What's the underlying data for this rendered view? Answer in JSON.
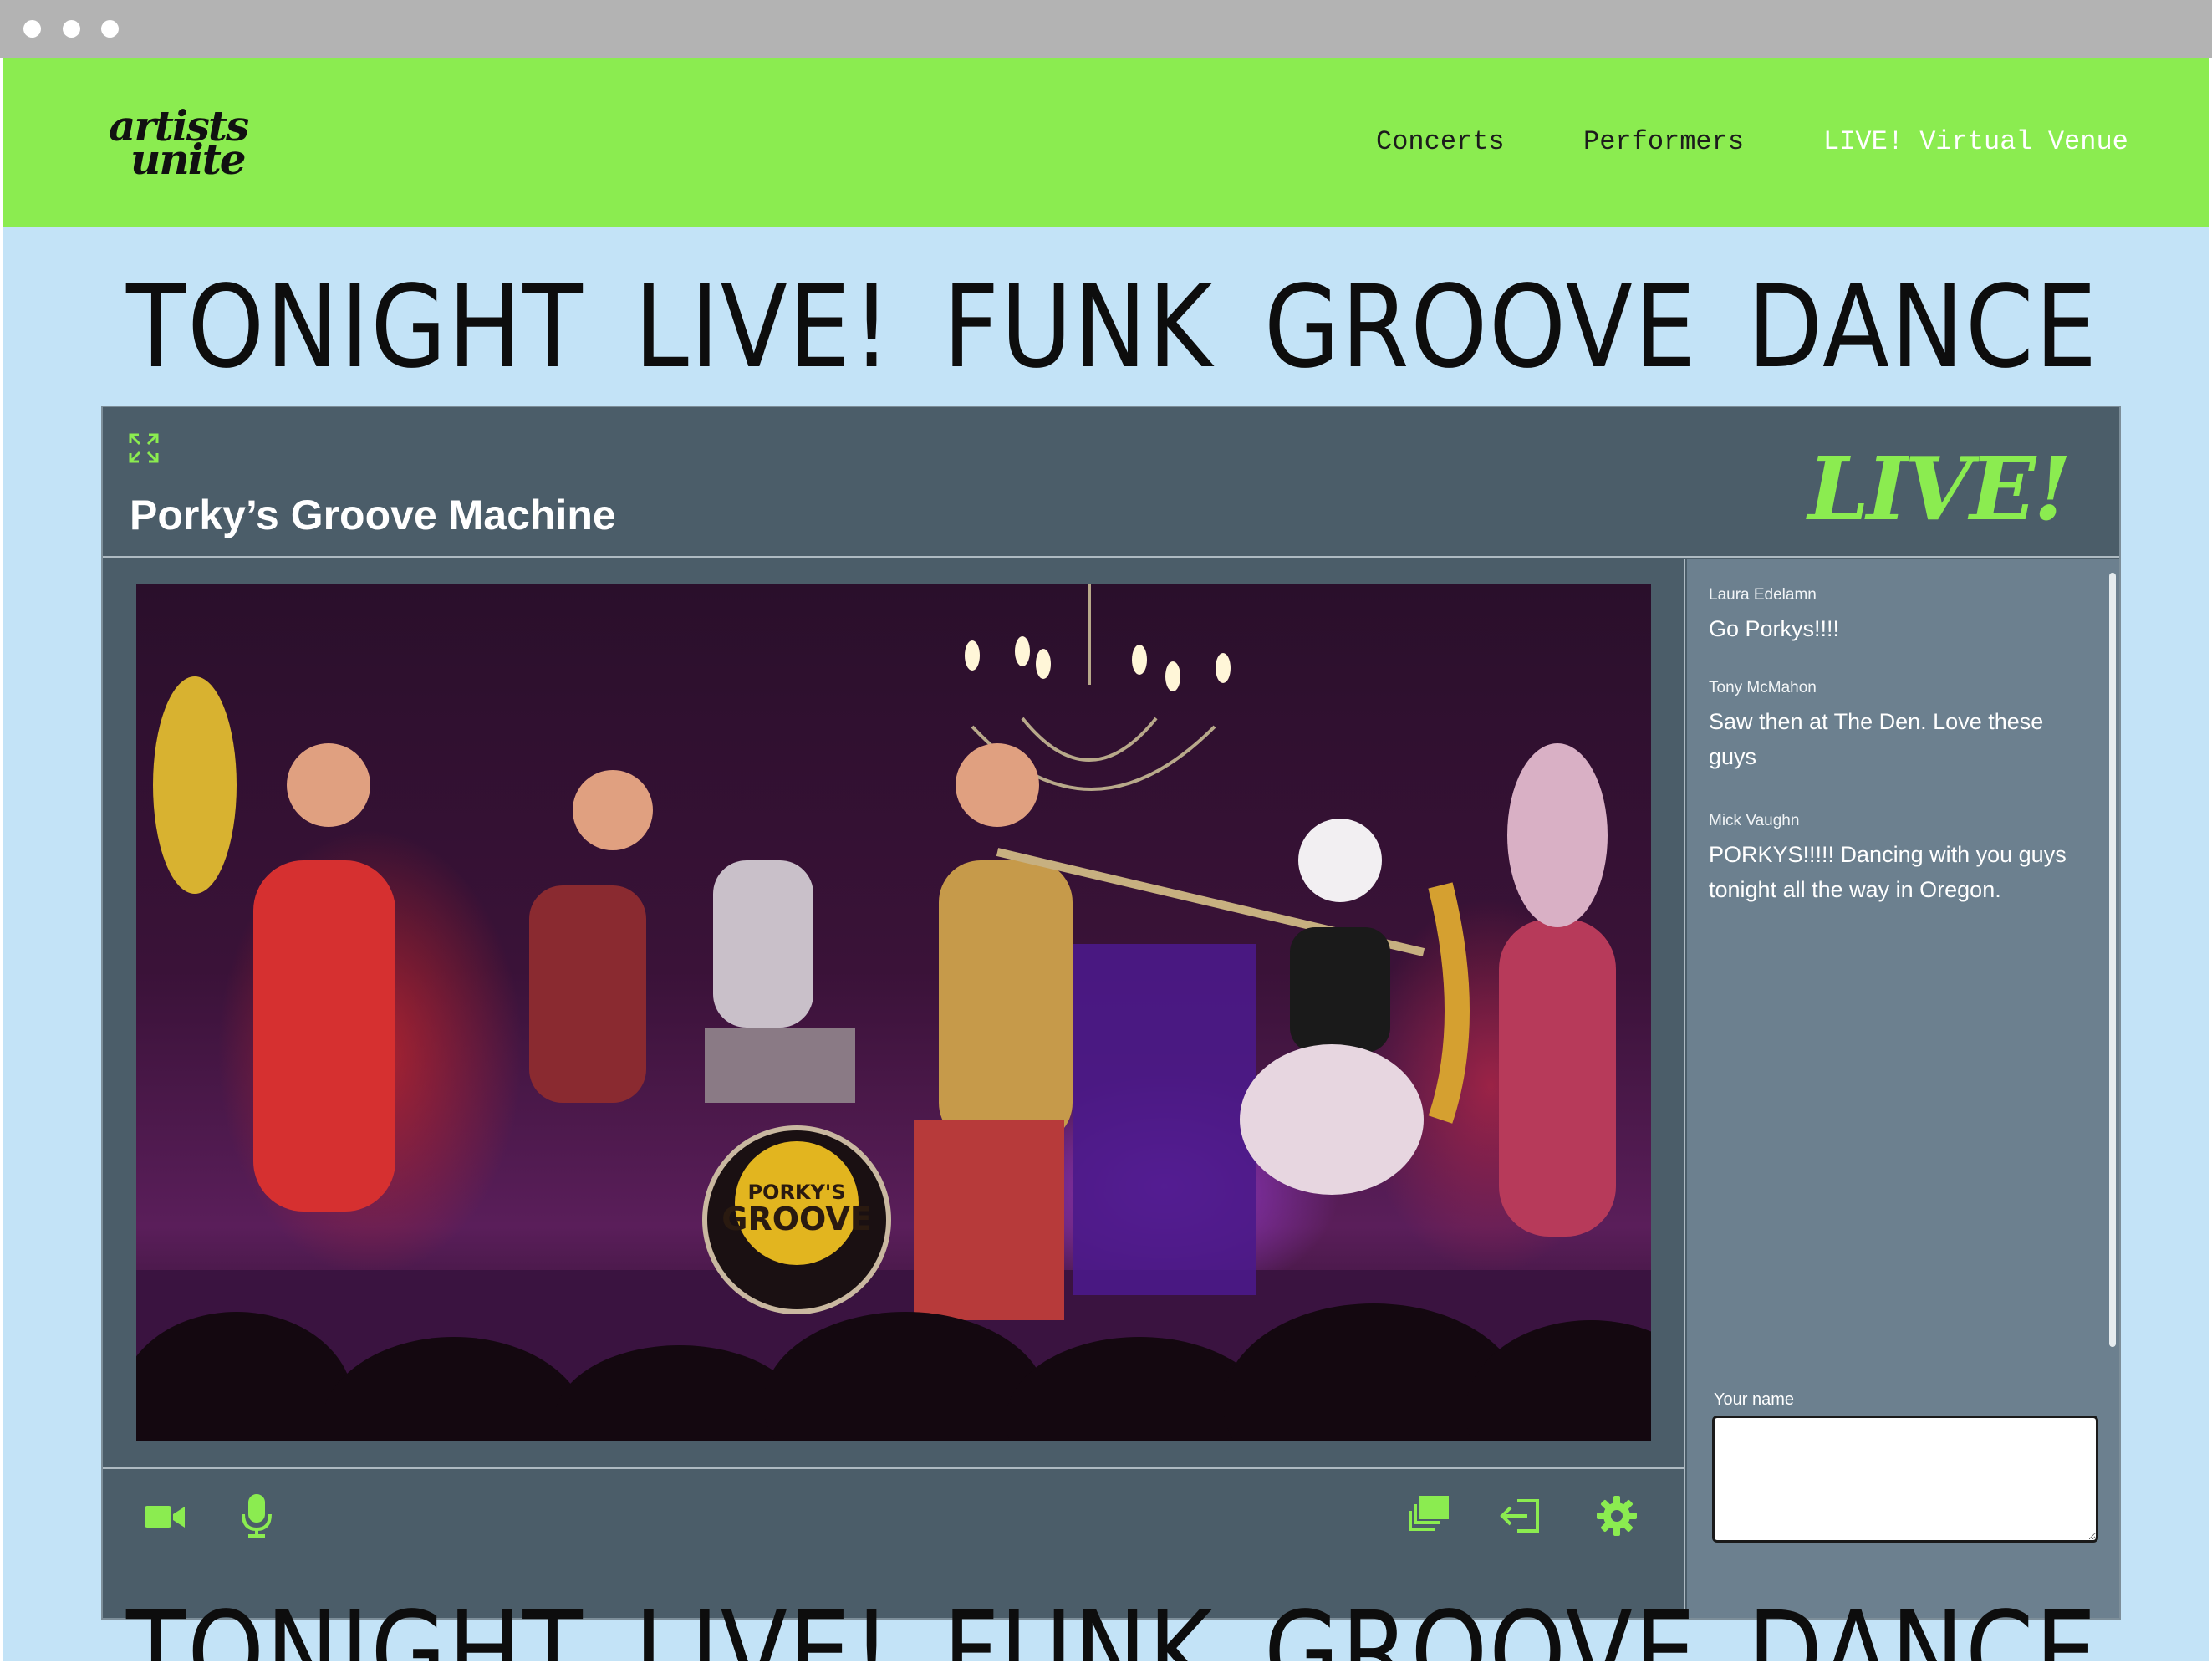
{
  "window": {
    "controls": [
      "close-dot",
      "minimize-dot",
      "maximize-dot"
    ]
  },
  "header": {
    "logo_line1": "artists",
    "logo_line2": "unite",
    "nav": [
      {
        "label": "Concerts"
      },
      {
        "label": "Performers"
      },
      {
        "label": "LIVE! Virtual Venue",
        "active": true
      }
    ]
  },
  "marquee": {
    "words": [
      "TONIGHT",
      "LIVE!",
      "FUNK",
      "GROOVE",
      "DANCE"
    ]
  },
  "player": {
    "title": "Porky’s Groove Machine",
    "live_badge": "LIVE!",
    "expand_icon": "expand-icon",
    "video_banner_text": "PORKY'S GROOVE machine",
    "controls_left": [
      "video-camera-icon",
      "microphone-icon"
    ],
    "controls_right": [
      "layers-icon",
      "exit-icon",
      "gear-icon"
    ]
  },
  "chat": {
    "messages": [
      {
        "author": "Laura Edelamn",
        "text": "Go Porkys!!!!"
      },
      {
        "author": "Tony McMahon",
        "text": "Saw then at The Den. Love these guys"
      },
      {
        "author": "Mick Vaughn",
        "text": "PORKYS!!!!! Dancing with you guys tonight all the way in Oregon."
      }
    ],
    "name_label": "Your name",
    "name_value": ""
  },
  "colors": {
    "accent_green": "#8bec50",
    "page_bg": "#c3e3f7",
    "player_bg": "#4b5d69",
    "chat_bg": "#6c808f"
  }
}
